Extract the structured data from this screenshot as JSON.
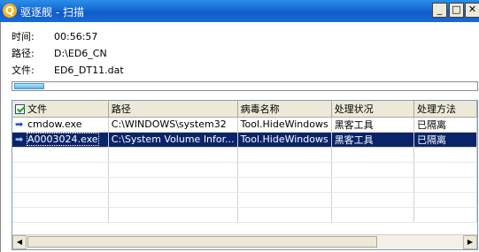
{
  "window": {
    "title": "驱逐舰 - 扫描",
    "app_icon_glyph": "Q",
    "min_glyph": "_",
    "max_glyph": "□",
    "close_glyph": "✕"
  },
  "scan_info": {
    "time_label": "时间:",
    "time_value": "00:56:57",
    "path_label": "路径:",
    "path_value": "D:\\ED6_CN",
    "file_label": "文件:",
    "file_value": "ED6_DT11.dat"
  },
  "progress": {
    "fraction": 0.065
  },
  "results": {
    "columns": [
      "文件",
      "路径",
      "病毒名称",
      "处理状况",
      "处理方法"
    ],
    "rows": [
      {
        "file": "cmdow.exe",
        "path": "C:\\WINDOWS\\system32",
        "virus": "Tool.HideWindows",
        "status": "黑客工具",
        "action": "已隔离"
      },
      {
        "file": "A0003024.exe",
        "path": "C:\\System Volume Infor...",
        "virus": "Tool.HideWindows",
        "status": "黑客工具",
        "action": "已隔离"
      }
    ],
    "selected_row": 1
  },
  "icons": {
    "header_checkbox": "checkbox-checked-icon",
    "row_icon": "threat-arrow-icon",
    "scroll_left": "scroll-left-icon",
    "scroll_right": "scroll-right-icon"
  }
}
